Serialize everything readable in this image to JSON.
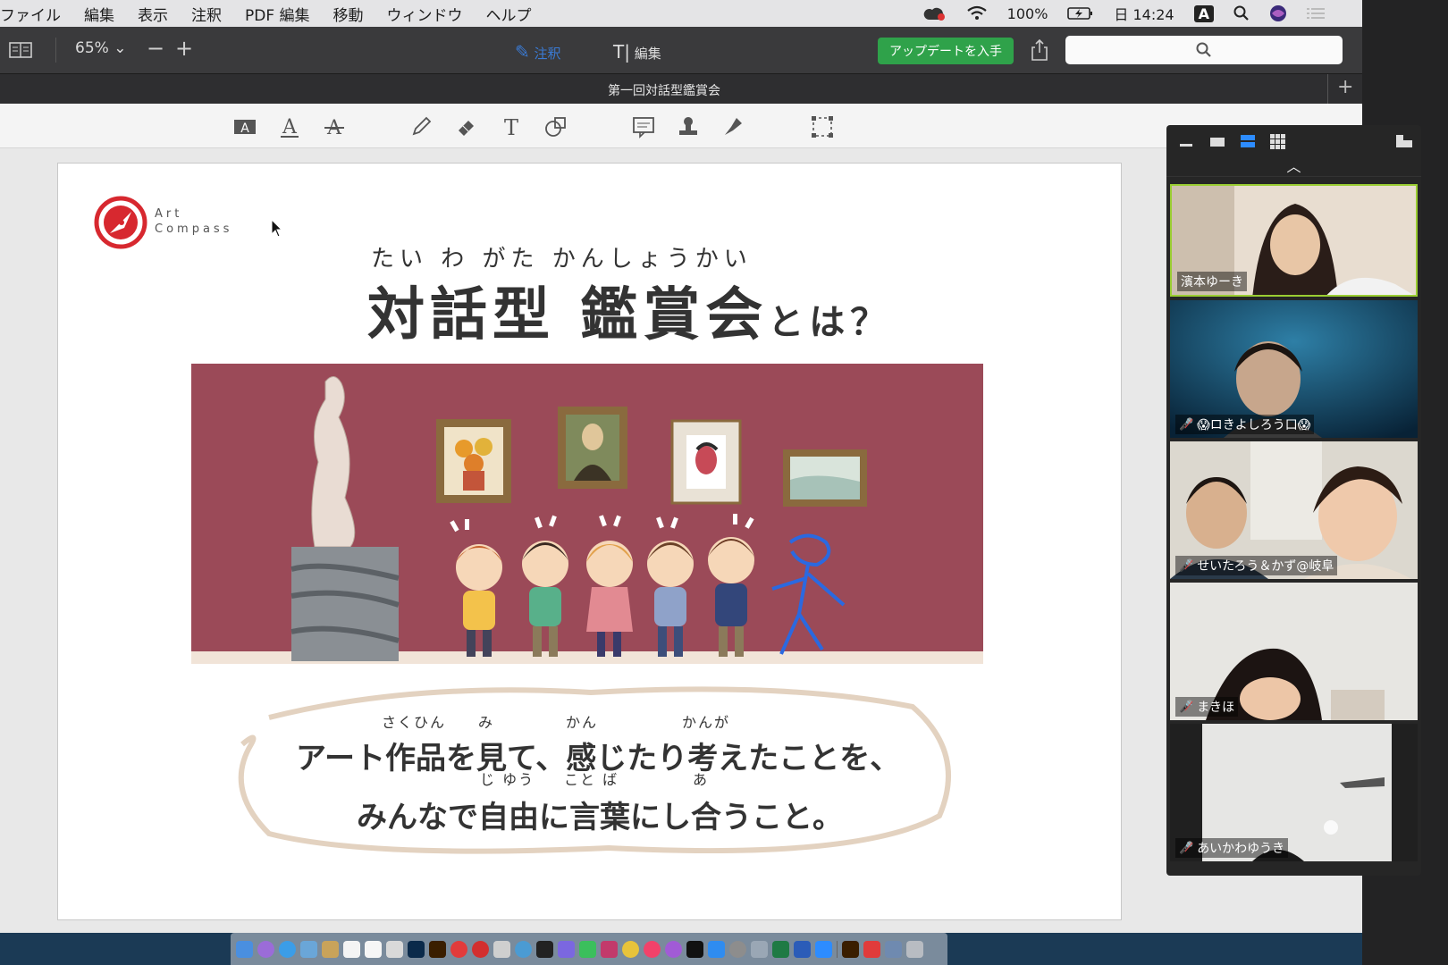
{
  "menubar": {
    "items": [
      "ファイル",
      "編集",
      "表示",
      "注釈",
      "PDF 編集",
      "移動",
      "ウィンドウ",
      "ヘルプ"
    ],
    "battery": "100%",
    "clock": "日 14:24",
    "input_method": "A"
  },
  "toolbar": {
    "zoom": "65%",
    "annotate_label": "注釈",
    "edit_label": "編集",
    "update_label": "アップデートを入手"
  },
  "tab": {
    "title": "第一回対話型鑑賞会"
  },
  "slide": {
    "logo_line1": "Art",
    "logo_line2": "Compass",
    "heading_ruby": "たい わ がた かんしょうかい",
    "heading_main": "対話型 鑑賞会",
    "heading_tail": "とは？",
    "line1": "アート作品を見て、感じたり考えたことを、",
    "line2": "みんなで自由に言葉にし合うこと。",
    "ruby_sakuhin": "さくひん",
    "ruby_mi": "み",
    "ruby_kan": "かん",
    "ruby_kanga": "かんが",
    "ruby_jiyuu": "じ ゆう",
    "ruby_kotoba": "こと ば",
    "ruby_a": "あ"
  },
  "participants": [
    {
      "name": "濱本ゆーき",
      "muted": false
    },
    {
      "name": "😱ロきよしろう口😱",
      "muted": true
    },
    {
      "name": "せいたろう＆かず@岐阜",
      "muted": true
    },
    {
      "name": "まきほ",
      "muted": true
    },
    {
      "name": "あいかわゆうき",
      "muted": true
    }
  ],
  "colors": {
    "update_green": "#2fa24a",
    "gallery_wall": "#9b4a58",
    "logo_red": "#d7282f"
  }
}
